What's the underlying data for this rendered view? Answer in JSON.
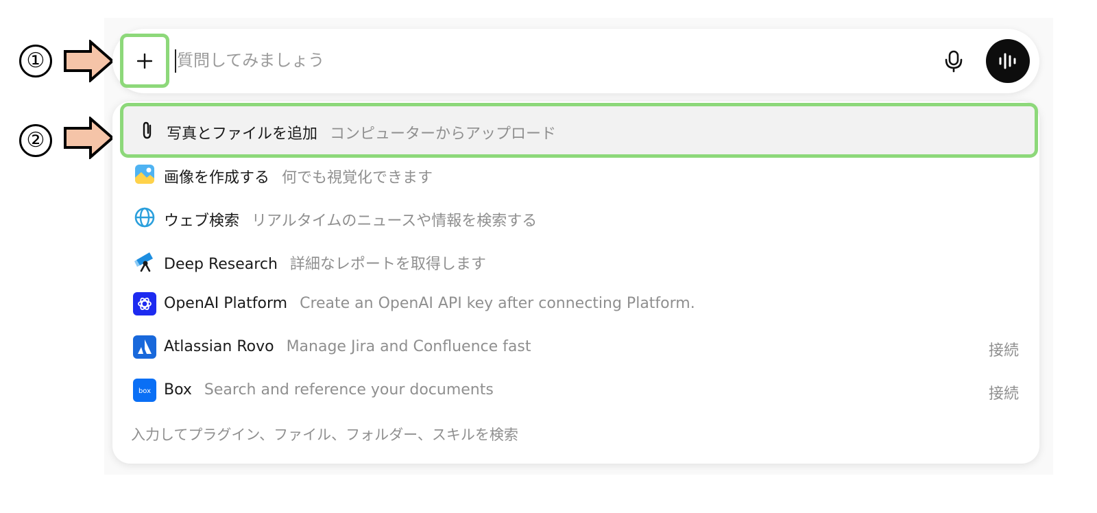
{
  "markers": {
    "step1": "①",
    "step2": "②"
  },
  "composer": {
    "placeholder": "質問してみましょう",
    "value": ""
  },
  "menu": {
    "items": [
      {
        "label": "写真とファイルを追加",
        "desc": "コンピューターからアップロード",
        "icon": "paperclip-icon",
        "right": ""
      },
      {
        "label": "画像を作成する",
        "desc": "何でも視覚化できます",
        "icon": "image-icon",
        "right": ""
      },
      {
        "label": "ウェブ検索",
        "desc": "リアルタイムのニュースや情報を検索する",
        "icon": "globe-icon",
        "right": ""
      },
      {
        "label": "Deep Research",
        "desc": "詳細なレポートを取得します",
        "icon": "telescope-icon",
        "right": ""
      },
      {
        "label": "OpenAI Platform",
        "desc": "Create an OpenAI API key after connecting Platform.",
        "icon": "openai-icon",
        "right": ""
      },
      {
        "label": "Atlassian Rovo",
        "desc": "Manage Jira and Confluence fast",
        "icon": "atlassian-icon",
        "right": "接続"
      },
      {
        "label": "Box",
        "desc": "Search and reference your documents",
        "icon": "box-icon",
        "right": "接続"
      }
    ],
    "hint": "入力してプラグイン、ファイル、フォルダー、スキルを検索"
  },
  "colors": {
    "highlight_border": "#8dd87a",
    "arrow_fill": "#f5c4a8",
    "voice_button": "#0d0d0d",
    "openai_icon_bg": "#1d2bf0",
    "atlassian_icon_bg": "#1868db",
    "box_icon_bg": "#0a6ff5"
  }
}
